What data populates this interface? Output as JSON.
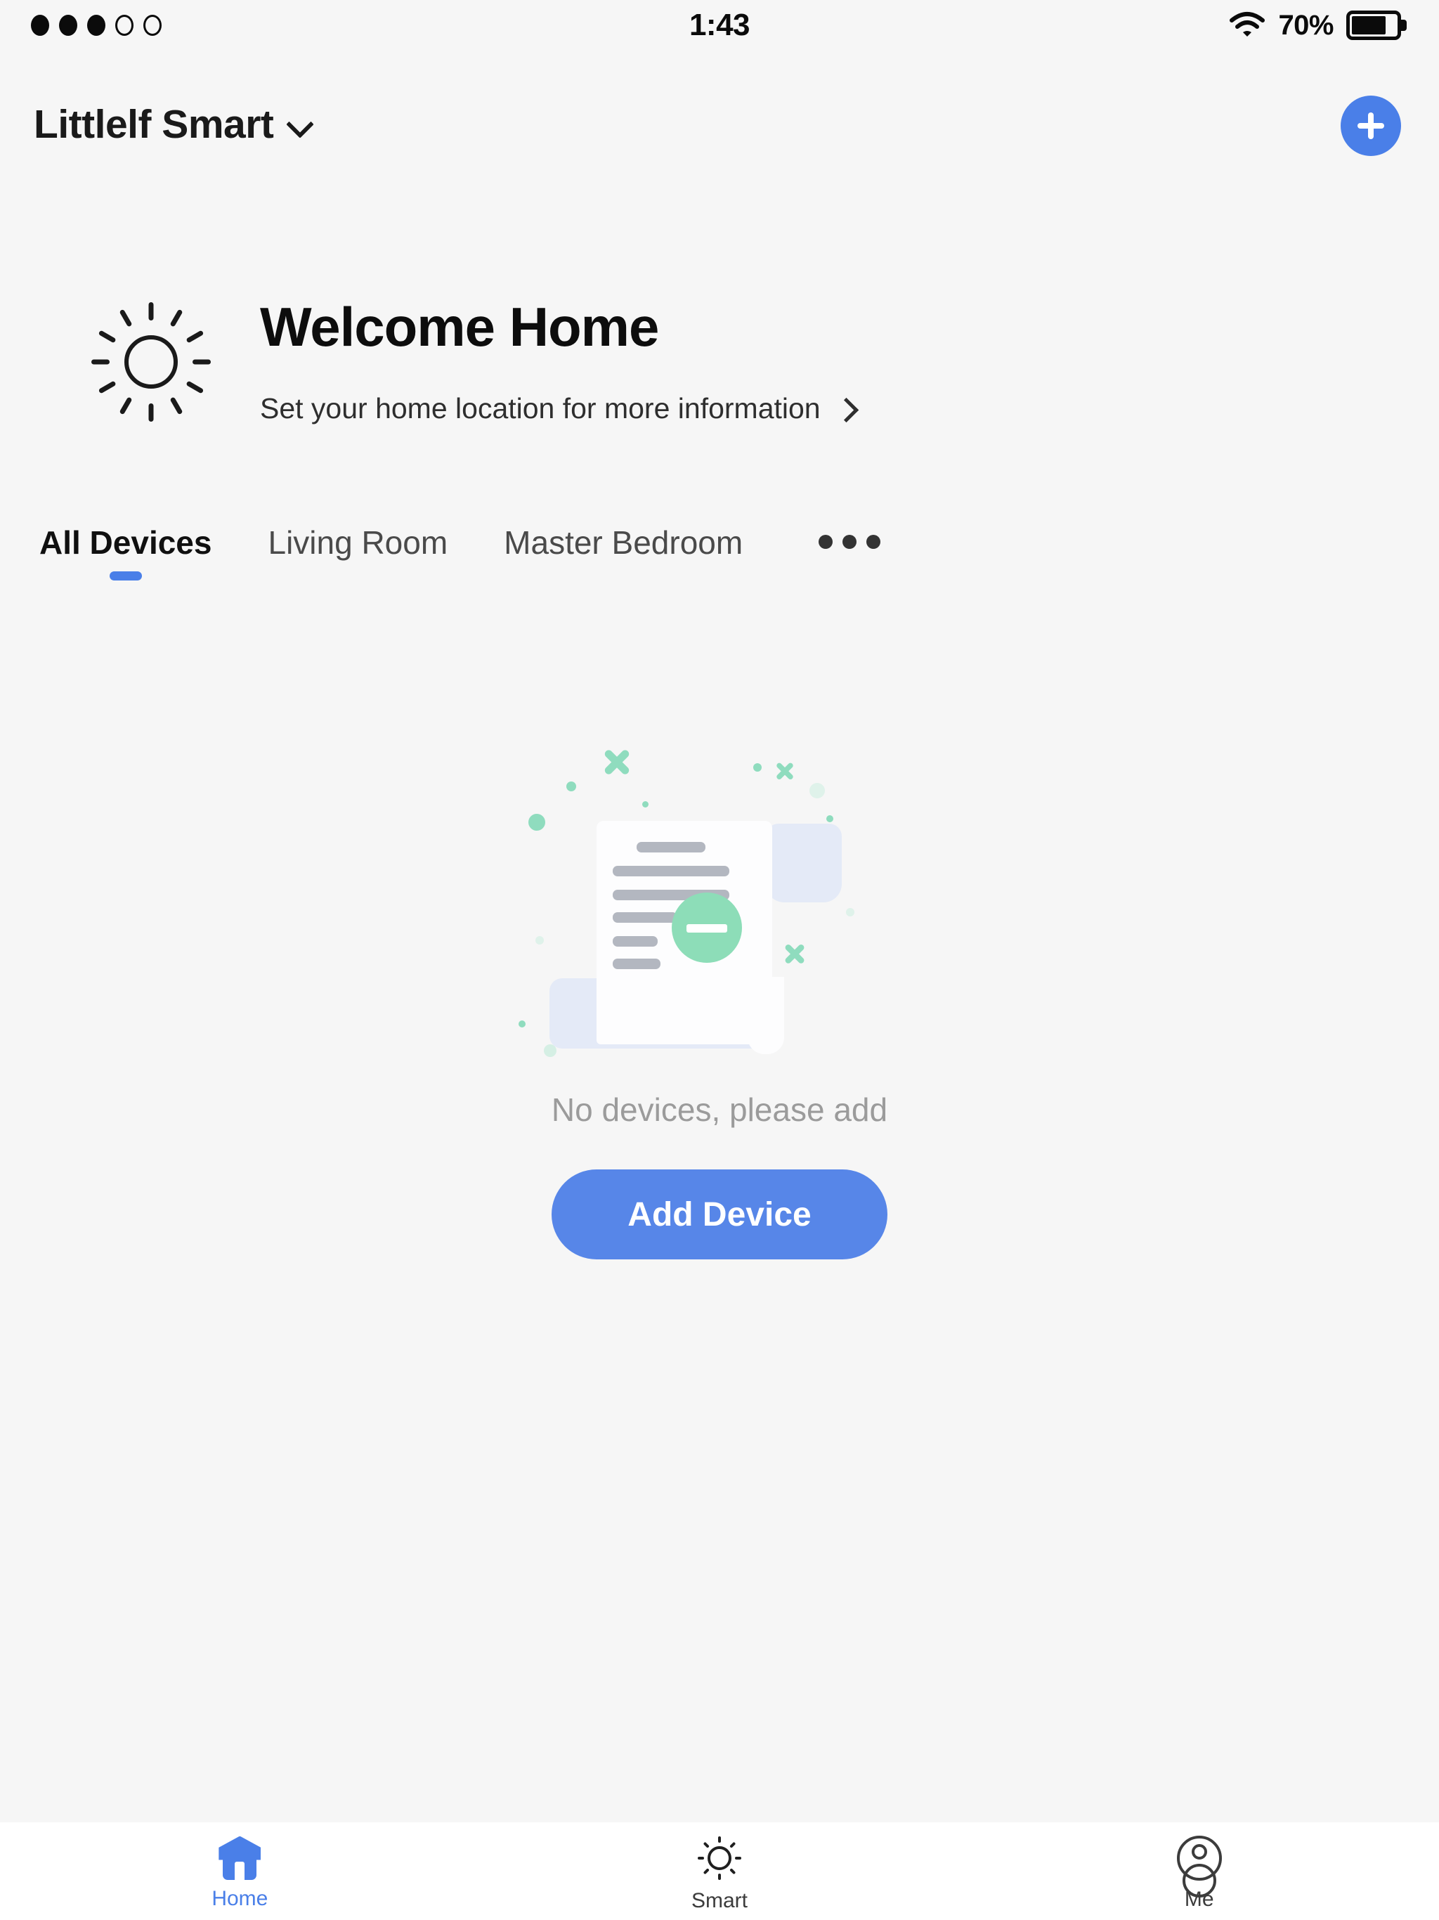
{
  "statusbar": {
    "signal_dots_filled": 3,
    "signal_dots_total": 5,
    "time": "1:43",
    "wifi_icon": "wifi-icon",
    "battery_percent": "70%",
    "battery_level": 70
  },
  "header": {
    "brand_title": "Littlelf Smart",
    "dropdown_icon": "chevron-down-icon",
    "add_icon": "plus-icon"
  },
  "welcome": {
    "weather_icon": "sun-icon",
    "title": "Welcome Home",
    "subtitle": "Set your home location for more information",
    "subtitle_arrow_icon": "chevron-right-icon"
  },
  "tabs": {
    "items": [
      {
        "label": "All Devices",
        "active": true
      },
      {
        "label": "Living Room",
        "active": false
      },
      {
        "label": "Master Bedroom",
        "active": false
      }
    ],
    "more_icon": "ellipsis-icon"
  },
  "empty_state": {
    "illustration_icon": "empty-document-icon",
    "message": "No devices, please add",
    "action_label": "Add Device"
  },
  "bottomnav": {
    "items": [
      {
        "label": "Home",
        "icon": "home-icon",
        "active": true
      },
      {
        "label": "Smart",
        "icon": "sun-icon",
        "active": false
      },
      {
        "label": "Me",
        "icon": "person-icon",
        "active": false
      }
    ]
  },
  "colors": {
    "accent_blue": "#4a7fe8",
    "button_blue": "#5786e8",
    "page_bg": "#f6f6f6",
    "nav_bg": "#ffffff",
    "muted_text": "#9b9b9b",
    "illus_green": "#8dddb8",
    "illus_blue": "#e4eaf7"
  }
}
